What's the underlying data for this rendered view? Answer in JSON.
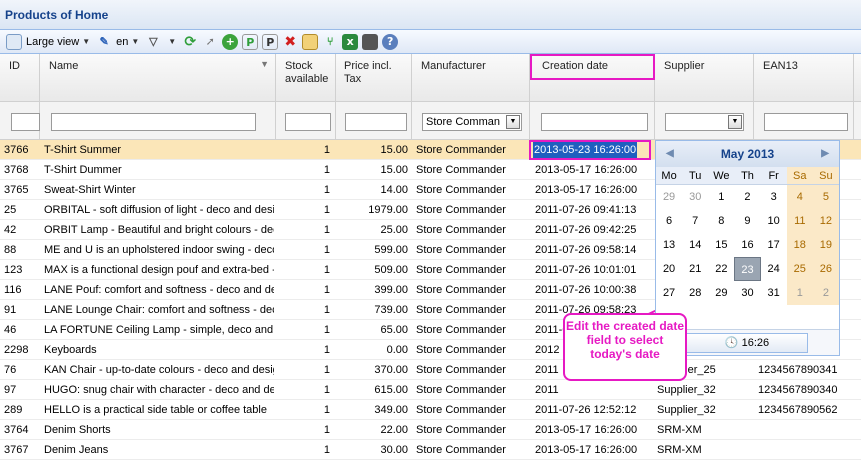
{
  "window_title": "Products of Home",
  "toolbar": {
    "view_label": "Large view",
    "lang_label": "en"
  },
  "columns": [
    "ID",
    "Name",
    "Stock available",
    "Price incl. Tax",
    "Manufacturer",
    "Creation date",
    "Supplier",
    "EAN13"
  ],
  "filters": {
    "manufacturer": "Store Comman"
  },
  "rows": [
    {
      "id": "3766",
      "name": "T-Shirt Summer",
      "stock": "1",
      "price": "15.00",
      "manufacturer": "Store Commander",
      "date": "2013-05-23 16:26:00",
      "supplier": "",
      "ean": "",
      "selected": true
    },
    {
      "id": "3768",
      "name": "T-Shirt Dummer",
      "stock": "1",
      "price": "15.00",
      "manufacturer": "Store Commander",
      "date": "2013-05-17 16:26:00",
      "supplier": "",
      "ean": ""
    },
    {
      "id": "3765",
      "name": "Sweat-Shirt Winter",
      "stock": "1",
      "price": "14.00",
      "manufacturer": "Store Commander",
      "date": "2013-05-17 16:26:00",
      "supplier": "",
      "ean": ""
    },
    {
      "id": "25",
      "name": "ORBITAL - soft diffusion of light - deco and desig",
      "stock": "1",
      "price": "1979.00",
      "manufacturer": "Store Commander",
      "date": "2011-07-26 09:41:13",
      "supplier": "",
      "ean": ""
    },
    {
      "id": "42",
      "name": "ORBIT Lamp - Beautiful and bright colours - deco",
      "stock": "1",
      "price": "25.00",
      "manufacturer": "Store Commander",
      "date": "2011-07-26 09:42:25",
      "supplier": "",
      "ean": ""
    },
    {
      "id": "88",
      "name": "ME and U is an upholstered indoor swing - deco a",
      "stock": "1",
      "price": "599.00",
      "manufacturer": "Store Commander",
      "date": "2011-07-26 09:58:14",
      "supplier": "",
      "ean": ""
    },
    {
      "id": "123",
      "name": "MAX is a functional design pouf and extra-bed -",
      "stock": "1",
      "price": "509.00",
      "manufacturer": "Store Commander",
      "date": "2011-07-26 10:01:01",
      "supplier": "",
      "ean": ""
    },
    {
      "id": "116",
      "name": "LANE Pouf: comfort and softness - deco and des",
      "stock": "1",
      "price": "399.00",
      "manufacturer": "Store Commander",
      "date": "2011-07-26 10:00:38",
      "supplier": "",
      "ean": ""
    },
    {
      "id": "91",
      "name": "LANE Lounge Chair: comfort and softness - deco",
      "stock": "1",
      "price": "739.00",
      "manufacturer": "Store Commander",
      "date": "2011-07-26 09:58:23",
      "supplier": "",
      "ean": ""
    },
    {
      "id": "46",
      "name": "LA FORTUNE Ceiling Lamp - simple, deco and des",
      "stock": "1",
      "price": "65.00",
      "manufacturer": "Store Commander",
      "date": "2011-07-26",
      "supplier": "",
      "ean": ""
    },
    {
      "id": "2298",
      "name": "Keyboards",
      "stock": "1",
      "price": "0.00",
      "manufacturer": "Store Commander",
      "date": "2012",
      "supplier": "",
      "ean": ""
    },
    {
      "id": "76",
      "name": "KAN Chair - up-to-date colours - deco and desig",
      "stock": "1",
      "price": "370.00",
      "manufacturer": "Store Commander",
      "date": "2011",
      "supplier": "Supplier_25",
      "ean": "1234567890341"
    },
    {
      "id": "97",
      "name": "HUGO: snug chair with character - deco and des",
      "stock": "1",
      "price": "615.00",
      "manufacturer": "Store Commander",
      "date": "2011",
      "supplier": "Supplier_32",
      "ean": "1234567890340"
    },
    {
      "id": "289",
      "name": "HELLO is a practical side table or coffee table",
      "stock": "1",
      "price": "349.00",
      "manufacturer": "Store Commander",
      "date": "2011-07-26 12:52:12",
      "supplier": "Supplier_32",
      "ean": "1234567890562"
    },
    {
      "id": "3764",
      "name": "Denim Shorts",
      "stock": "1",
      "price": "22.00",
      "manufacturer": "Store Commander",
      "date": "2013-05-17 16:26:00",
      "supplier": "SRM-XM",
      "ean": ""
    },
    {
      "id": "3767",
      "name": "Denim Jeans",
      "stock": "1",
      "price": "30.00",
      "manufacturer": "Store Commander",
      "date": "2013-05-17 16:26:00",
      "supplier": "SRM-XM",
      "ean": ""
    }
  ],
  "calendar": {
    "month_label": "May 2013",
    "days_of_week": [
      "Mo",
      "Tu",
      "We",
      "Th",
      "Fr",
      "Sa",
      "Su"
    ],
    "weeks": [
      [
        "29",
        "30",
        "1",
        "2",
        "3",
        "4",
        "5"
      ],
      [
        "6",
        "7",
        "8",
        "9",
        "10",
        "11",
        "12"
      ],
      [
        "13",
        "14",
        "15",
        "16",
        "17",
        "18",
        "19"
      ],
      [
        "20",
        "21",
        "22",
        "23",
        "24",
        "25",
        "26"
      ],
      [
        "27",
        "28",
        "29",
        "30",
        "31",
        "1",
        "2"
      ]
    ],
    "selected_day": "23",
    "time_label": "16:26"
  },
  "callout_text": "Edit the created date field to select today's date",
  "colors": {
    "highlight": "#e619c3",
    "selected_row": "#fbe6b8",
    "header_text": "#15428b"
  }
}
